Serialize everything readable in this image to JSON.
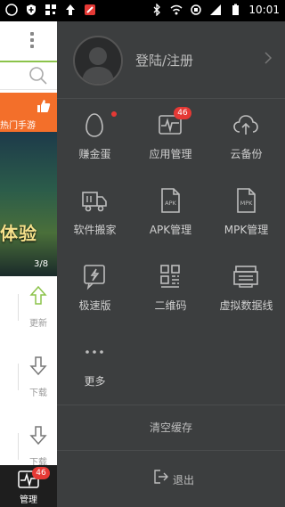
{
  "status_bar": {
    "time": "10:01",
    "left_icons": [
      "whatsapp-icon",
      "shield-icon",
      "qr-icon",
      "upload-icon",
      "tag-icon"
    ],
    "right_icons": [
      "bluetooth-icon",
      "wifi-icon",
      "sync-icon",
      "signal-icon",
      "battery-icon"
    ]
  },
  "underlying": {
    "promo_label": "热门手游",
    "banner_text": "体验",
    "banner_page": "3/8",
    "rows": [
      {
        "action": "更新",
        "icon": "arrow-up-icon"
      },
      {
        "action": "下载",
        "icon": "arrow-down-icon"
      },
      {
        "action": "下载",
        "icon": "arrow-down-icon"
      }
    ],
    "bottom_tab": {
      "label": "管理",
      "badge": "46"
    }
  },
  "drawer": {
    "login_text": "登陆/注册",
    "grid": [
      {
        "label": "赚金蛋",
        "icon": "egg-icon",
        "dot": true
      },
      {
        "label": "应用管理",
        "icon": "pulse-monitor-icon",
        "badge": "46"
      },
      {
        "label": "云备份",
        "icon": "cloud-upload-icon"
      },
      {
        "label": "软件搬家",
        "icon": "truck-icon"
      },
      {
        "label": "APK管理",
        "icon": "apk-file-icon",
        "icon_text": "APK"
      },
      {
        "label": "MPK管理",
        "icon": "mpk-file-icon",
        "icon_text": "MPK"
      },
      {
        "label": "极速版",
        "icon": "lightning-phone-icon"
      },
      {
        "label": "二维码",
        "icon": "qr-code-icon"
      },
      {
        "label": "虚拟数据线",
        "icon": "printer-icon"
      },
      {
        "label": "更多",
        "icon": "more-dots-icon"
      }
    ],
    "clear_cache": "清空缓存",
    "logout": "退出"
  },
  "colors": {
    "drawer_bg": "#3c3e3f",
    "accent_green": "#8bc34a",
    "badge_red": "#e53935",
    "promo_orange": "#f36f2a"
  }
}
